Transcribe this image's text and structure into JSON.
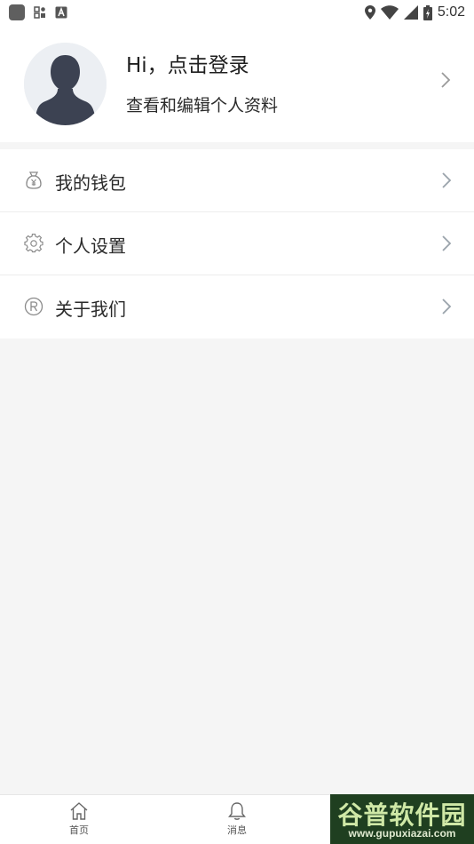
{
  "status_bar": {
    "time": "5:02",
    "icons": [
      "app-icon",
      "grid-icon",
      "a-icon",
      "location-icon",
      "wifi-icon",
      "signal-icon",
      "battery-icon"
    ]
  },
  "profile": {
    "greeting": "Hi，点击登录",
    "subtitle": "查看和编辑个人资料"
  },
  "menu": {
    "items": [
      {
        "label": "我的钱包",
        "icon": "wallet-icon"
      },
      {
        "label": "个人设置",
        "icon": "gear-icon"
      },
      {
        "label": "关于我们",
        "icon": "registered-icon"
      }
    ]
  },
  "bottom_nav": {
    "items": [
      {
        "label": "首页",
        "icon": "home-icon"
      },
      {
        "label": "消息",
        "icon": "bell-icon"
      }
    ]
  },
  "watermark": {
    "title": "谷普软件园",
    "url": "www.gupuxiazai.com"
  },
  "colors": {
    "background": "#f5f5f5",
    "card": "#ffffff",
    "icon_gray": "#8a8a8a",
    "avatar_bg": "#eceff3",
    "avatar_fg": "#3c4252"
  }
}
